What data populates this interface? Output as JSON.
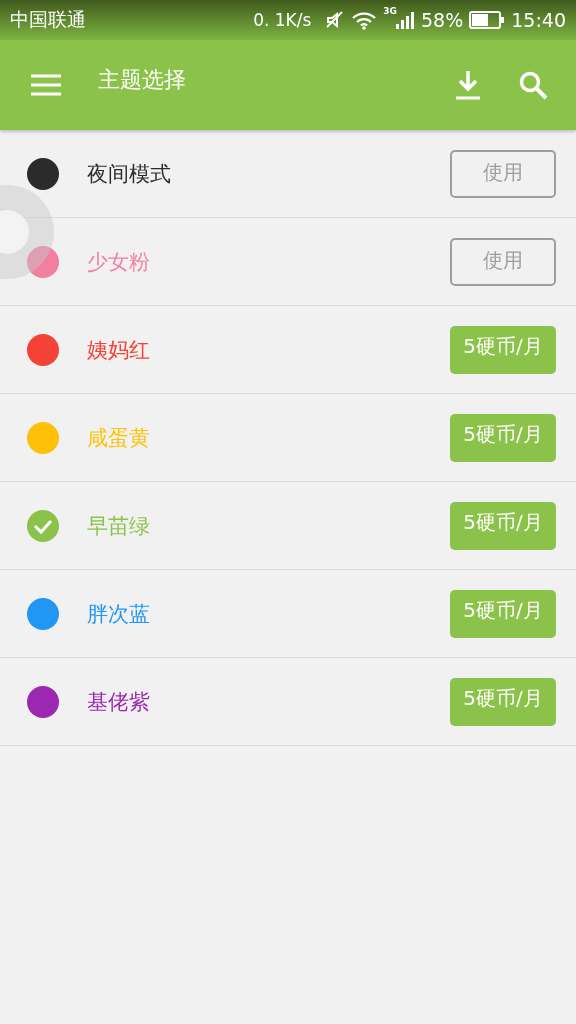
{
  "status_bar": {
    "carrier": "中国联通",
    "speed": "0. 1K/s",
    "network": "3G",
    "battery": "58%",
    "time": "15:40"
  },
  "app_bar": {
    "title": "主题选择"
  },
  "themes": [
    {
      "name": "夜间模式",
      "color": "#2b2b2b",
      "selected": false,
      "action": {
        "kind": "use",
        "label": "使用"
      }
    },
    {
      "name": "少女粉",
      "color": "#f27ea0",
      "selected": false,
      "action": {
        "kind": "use",
        "label": "使用"
      }
    },
    {
      "name": "姨妈红",
      "color": "#f44336",
      "selected": false,
      "action": {
        "kind": "buy",
        "label": "5硬币/月"
      }
    },
    {
      "name": "咸蛋黄",
      "color": "#ffc107",
      "selected": false,
      "action": {
        "kind": "buy",
        "label": "5硬币/月"
      }
    },
    {
      "name": "早苗绿",
      "color": "#8bc34a",
      "selected": true,
      "action": {
        "kind": "buy",
        "label": "5硬币/月"
      }
    },
    {
      "name": "胖次蓝",
      "color": "#2196f3",
      "selected": false,
      "action": {
        "kind": "buy",
        "label": "5硬币/月"
      }
    },
    {
      "name": "基佬紫",
      "color": "#9c27b0",
      "selected": false,
      "action": {
        "kind": "buy",
        "label": "5硬币/月"
      }
    }
  ]
}
